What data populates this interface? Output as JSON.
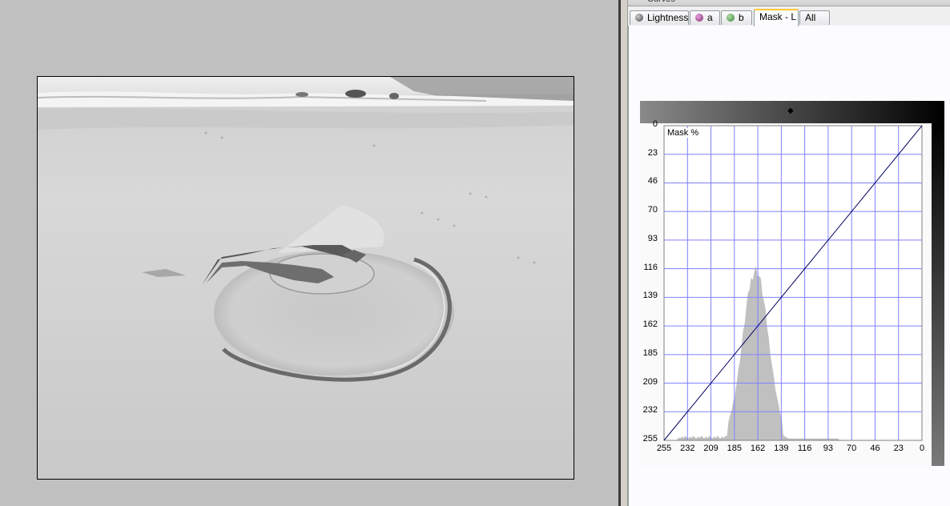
{
  "panel": {
    "title": "Curves"
  },
  "tabs": [
    {
      "label": "Lightness",
      "icon": "lightness-icon",
      "color": "#666666"
    },
    {
      "label": "a",
      "icon": "a-channel-icon",
      "color": "#b04aa0"
    },
    {
      "label": "b",
      "icon": "b-channel-icon",
      "color": "#5aa050"
    },
    {
      "label": "Mask - L",
      "icon": "",
      "color": ""
    },
    {
      "label": "All",
      "icon": "",
      "color": ""
    }
  ],
  "active_tab": "Mask - L",
  "curve": {
    "mask_label": "Mask %",
    "y_ticks": [
      "0",
      "23",
      "46",
      "70",
      "93",
      "116",
      "139",
      "162",
      "185",
      "209",
      "232",
      "255"
    ],
    "x_ticks": [
      "255",
      "232",
      "209",
      "185",
      "162",
      "139",
      "116",
      "93",
      "70",
      "46",
      "23",
      "0"
    ],
    "grid_color": "#8080ff",
    "curve_color": "#000060",
    "histogram_color": "#c0c0c0"
  },
  "chart_data": {
    "type": "line",
    "x": [
      255,
      0
    ],
    "series": [
      {
        "values": [
          255,
          0
        ]
      }
    ],
    "xlim": [
      255,
      0
    ],
    "ylim": [
      0,
      255
    ]
  }
}
